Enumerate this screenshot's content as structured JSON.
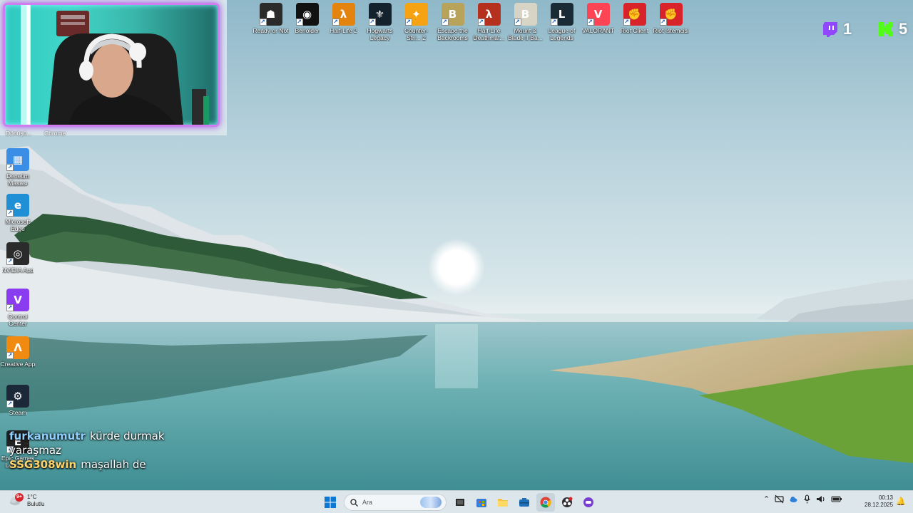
{
  "desktop": {
    "top_icons": [
      {
        "label": "Ready or Not",
        "icon": "ready-or-not-icon",
        "bg": "#2b2b2b",
        "glyph": "☗"
      },
      {
        "label": "Beholder",
        "icon": "beholder-icon",
        "bg": "#111111",
        "glyph": "◉"
      },
      {
        "label": "Half-Life 2",
        "icon": "half-life-2-icon",
        "bg": "#e5830f",
        "glyph": "λ"
      },
      {
        "label": "Hogwarts Legacy",
        "icon": "hogwarts-legacy-icon",
        "bg": "#14222e",
        "glyph": "⚜"
      },
      {
        "label": "Counter-Stri... 2",
        "icon": "counter-strike-2-icon",
        "bg": "#f6a313",
        "glyph": "✦"
      },
      {
        "label": "Escape the Backrooms",
        "icon": "escape-the-backrooms-icon",
        "bg": "#b8a35b",
        "glyph": "B"
      },
      {
        "label": "Half-Life Deathmat...",
        "icon": "half-life-deathmatch-icon",
        "bg": "#b5301d",
        "glyph": "λ"
      },
      {
        "label": "Mount & Blade II Ba...",
        "icon": "mount-and-blade-icon",
        "bg": "#d7d4c6",
        "glyph": "B"
      },
      {
        "label": "League of Legends",
        "icon": "league-of-legends-icon",
        "bg": "#1b2b36",
        "glyph": "L"
      },
      {
        "label": "VALORANT",
        "icon": "valorant-icon",
        "bg": "#fc4454",
        "glyph": "V"
      },
      {
        "label": "Riot Client",
        "icon": "riot-client-icon",
        "bg": "#d8232a",
        "glyph": "✊"
      },
      {
        "label": "Riot İstemcisi",
        "icon": "riot-istemcisi-icon",
        "bg": "#d8232a",
        "glyph": "✊"
      }
    ],
    "left_icons": [
      {
        "label": "Denetim Masası",
        "icon": "control-panel-icon",
        "bg": "#3a8ee6",
        "glyph": "▦"
      },
      {
        "label": "Microsoft Edge",
        "icon": "edge-icon",
        "bg": "#1f8fd6",
        "glyph": "e"
      },
      {
        "label": "NVIDIA App",
        "icon": "nvidia-app-icon",
        "bg": "#2b2b2b",
        "glyph": "◎"
      },
      {
        "label": "Control Center",
        "icon": "control-center-icon",
        "bg": "#8a3df0",
        "glyph": "V"
      },
      {
        "label": "Creative App",
        "icon": "creative-app-icon",
        "bg": "#f08a10",
        "glyph": "Λ"
      },
      {
        "label": "Steam",
        "icon": "steam-icon",
        "bg": "#1b2838",
        "glyph": "⚙"
      },
      {
        "label": "Epic Games Launcher",
        "icon": "epic-games-icon",
        "bg": "#222222",
        "glyph": "E"
      }
    ],
    "under_cam_labels": [
      "Dönüşü...",
      "Chrome"
    ]
  },
  "overlay": {
    "counters": [
      {
        "platform": "twitch",
        "icon": "twitch-icon",
        "color": "#9146ff",
        "value": "1"
      },
      {
        "platform": "kick",
        "icon": "kick-icon",
        "color": "#53fc18",
        "value": "5"
      }
    ],
    "chat": [
      {
        "user": "furkanumutr",
        "user_color": "#8fd0ff",
        "message": "kürde durmak yaraşmaz"
      },
      {
        "user": "SSG308win",
        "user_color": "#ffd36b",
        "message": "maşallah de"
      }
    ]
  },
  "taskbar": {
    "weather": {
      "badge": "9+",
      "temp": "1°C",
      "condition": "Bulutlu",
      "icon": "cloud-weather-icon"
    },
    "search_placeholder": "Ara",
    "apps": [
      {
        "name": "start",
        "icon": "windows-start-icon"
      },
      {
        "name": "task-view",
        "icon": "task-view-icon"
      },
      {
        "name": "store",
        "icon": "store-icon"
      },
      {
        "name": "explorer",
        "icon": "folder-icon"
      },
      {
        "name": "toolbox",
        "icon": "toolbox-icon"
      },
      {
        "name": "chrome",
        "icon": "chrome-icon"
      },
      {
        "name": "obs",
        "icon": "obs-icon"
      },
      {
        "name": "app",
        "icon": "purple-app-icon"
      }
    ],
    "tray_icons": [
      "chevron-up-icon",
      "network-off-icon",
      "cloud-icon",
      "microphone-icon",
      "volume-icon",
      "battery-icon"
    ],
    "time": "00:13",
    "date": "28.12.2025"
  }
}
